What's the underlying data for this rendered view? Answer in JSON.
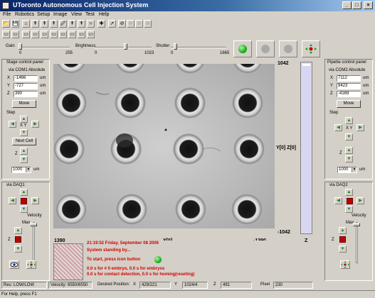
{
  "window": {
    "title": "UToronto Autonomous Cell Injection System",
    "min": "_",
    "max": "□",
    "close": "×"
  },
  "menu": [
    "File",
    "Robotics",
    "Setup",
    "Image",
    "View",
    "Test",
    "Help"
  ],
  "toolbar": {
    "row1": [
      "📂",
      "💾",
      "⌂",
      "↟",
      "↟",
      "↟",
      "🖉",
      "↟",
      "↟",
      "■",
      "✚",
      "➚",
      "⊘",
      "⊘",
      "⊘",
      "⊘"
    ],
    "row2": [
      "▭",
      "▭",
      "▭",
      "▭",
      "▭",
      "▭",
      "▭",
      "▭",
      "▭",
      "▭"
    ]
  },
  "sliders": {
    "gain": {
      "label": "Gain",
      "min": "0",
      "max": "255",
      "value": 0
    },
    "brightness": {
      "label": "Brightness",
      "min": "0",
      "max": "1023",
      "value": 0.55
    },
    "shutter": {
      "label": "Shutter",
      "min": "0",
      "max": "1665",
      "value": 0.05
    }
  },
  "left_panel": {
    "title": "Stage control panel",
    "via": "via COM1 Absolute",
    "x_label": "X",
    "x_value": "-1466",
    "x_unit": "um",
    "y_label": "Y",
    "y_value": "-727",
    "y_unit": "um",
    "z_label": "Z",
    "z_value": "390",
    "z_unit": "um",
    "move": "Move",
    "step": "Step",
    "xy": "X Y",
    "next_cell": "Next Cell",
    "z": "Z",
    "step_value": "1000",
    "step_unit": "um",
    "daq": "via DAQ1",
    "velocity": "Velocity",
    "max": "Max",
    "z2": "Z"
  },
  "right_panel": {
    "title": "Pipette control panel",
    "via": "via COM2 Absolute",
    "x_label": "X",
    "x_value": "7112",
    "x_unit": "um",
    "y_label": "Y",
    "y_value": "9423",
    "y_unit": "um",
    "z_label": "Z",
    "z_value": "-4169",
    "z_unit": "um",
    "move": "Move",
    "step": "Step",
    "xy": "X Y",
    "z": "Z",
    "step_value": "1000",
    "step_unit": "um",
    "daq": "via DAQ2",
    "velocity": "Velocity",
    "max": "Max",
    "z2": "Z"
  },
  "image_view": {
    "y_top": "1042",
    "y_bottom": "-1042",
    "y_axis": "Y[0] Z[0]",
    "x_left": "1390",
    "x_axis": "X[0]",
    "x_right": "-1390",
    "z_label": "Z"
  },
  "messages": [
    "21:19:52 Friday, September 08 2006",
    "System standing by...",
    "To start, press icon button",
    "0.0 s for # 0 embryo, 0.0 s for embryos",
    "0.0 s for contact detection, 0.0 s for homing(reseting)"
  ],
  "status": {
    "res": "Res: LOW/LOW",
    "velocity": "Velocity: 6550/6550",
    "desired": "Desired Position:",
    "x_label": "X",
    "x_value": "429/221",
    "y_label": "Y",
    "y_value": "1024/4",
    "z_label": "Z",
    "z_value": "491",
    "pixel_label": "Pixel",
    "pixel_value": "230"
  },
  "help": "For Help, press F1",
  "colors": {
    "message_red": "#d40000",
    "go_green": "#0aa10a",
    "title_blue": "#0a246a"
  }
}
